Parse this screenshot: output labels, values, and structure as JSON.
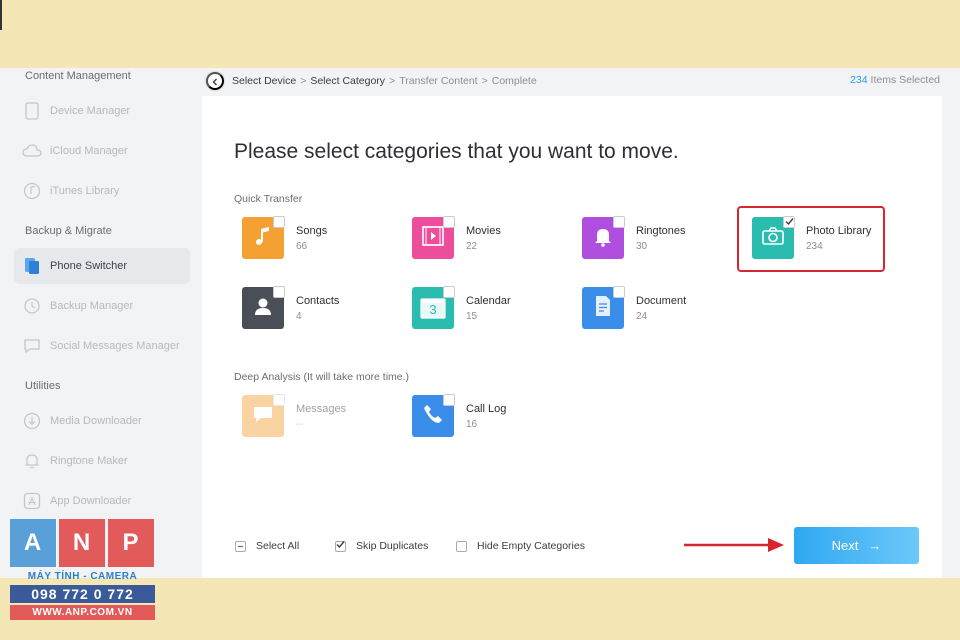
{
  "sidebar": {
    "sections": {
      "content": "Content Management",
      "backup": "Backup & Migrate",
      "utilities": "Utilities"
    },
    "items": [
      {
        "label": "Device Manager",
        "icon": "phone-icon"
      },
      {
        "label": "iCloud Manager",
        "icon": "cloud-icon"
      },
      {
        "label": "iTunes Library",
        "icon": "music-icon"
      },
      {
        "label": "Phone Switcher",
        "icon": "phone-switch-icon",
        "active": true
      },
      {
        "label": "Backup Manager",
        "icon": "history-icon"
      },
      {
        "label": "Social Messages Manager",
        "icon": "chat-icon"
      },
      {
        "label": "Media Downloader",
        "icon": "download-icon"
      },
      {
        "label": "Ringtone Maker",
        "icon": "bell-icon"
      },
      {
        "label": "App Downloader",
        "icon": "app-store-icon"
      }
    ]
  },
  "breadcrumb": {
    "steps": [
      "Select Device",
      "Select Category",
      "Transfer Content",
      "Complete"
    ],
    "sep": ">"
  },
  "selection": {
    "count": "234",
    "label": "Items Selected"
  },
  "main": {
    "heading": "Please select categories that you want to move.",
    "quick_label": "Quick Transfer",
    "deep_label": "Deep Analysis (It will take more time.)"
  },
  "categories": {
    "songs": {
      "name": "Songs",
      "count": "66",
      "color": "#f5a033"
    },
    "movies": {
      "name": "Movies",
      "count": "22",
      "color": "#ec4e9c"
    },
    "ringtones": {
      "name": "Ringtones",
      "count": "30",
      "color": "#b04ee0"
    },
    "photos": {
      "name": "Photo Library",
      "count": "234",
      "color": "#2bbcb0",
      "checked": true
    },
    "contacts": {
      "name": "Contacts",
      "count": "4",
      "color": "#4a4f57"
    },
    "calendar": {
      "name": "Calendar",
      "count": "15",
      "color": "#2bbcb0"
    },
    "document": {
      "name": "Document",
      "count": "24",
      "color": "#3a8de8"
    },
    "messages": {
      "name": "Messages",
      "count": "--",
      "color": "#f5a033",
      "disabled": true
    },
    "calllog": {
      "name": "Call Log",
      "count": "16",
      "color": "#3a8de8"
    }
  },
  "footer": {
    "select_all": "Select All",
    "skip_duplicates": "Skip Duplicates",
    "hide_empty": "Hide Empty Categories",
    "next": "Next",
    "next_arrow": "→"
  },
  "calendar_digit": "3",
  "logo": {
    "letters": [
      "A",
      "N",
      "P"
    ],
    "tagline": "MÁY TÍNH - CAMERA",
    "phone": "098 772 0 772",
    "website": "WWW.ANP.COM.VN"
  },
  "colors": {
    "accent": "#2b9bf0",
    "highlight": "#d8262f",
    "background_band": "#f4e6b5"
  }
}
